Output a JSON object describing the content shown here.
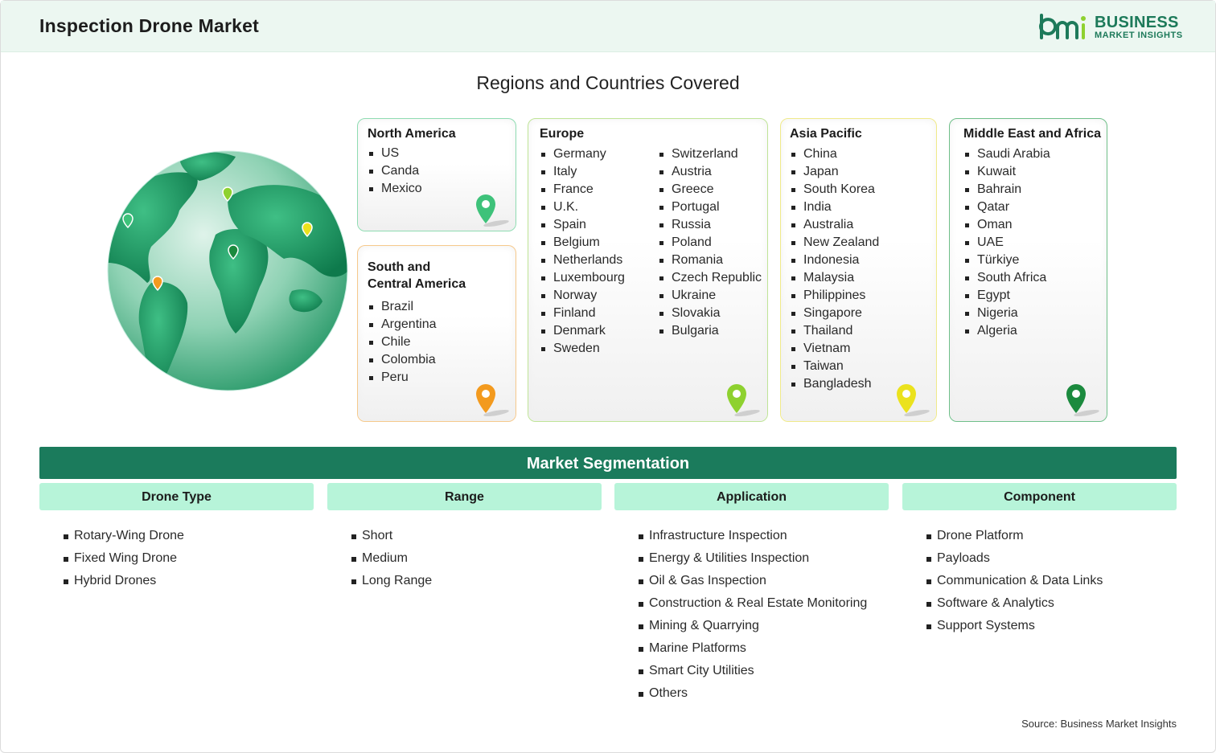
{
  "header": {
    "title": "Inspection Drone Market",
    "logo": {
      "mark": "bmi",
      "line1": "BUSINESS",
      "line2": "MARKET INSIGHTS"
    }
  },
  "regions_title": "Regions and Countries Covered",
  "regions": {
    "north_america": {
      "title": "North America",
      "countries": [
        "US",
        "Canda",
        "Mexico"
      ],
      "pin_color": "#3ec27a"
    },
    "south_central_america": {
      "title_line1": "South and",
      "title_line2": "Central America",
      "countries": [
        "Brazil",
        "Argentina",
        "Chile",
        "Colombia",
        "Peru"
      ],
      "pin_color": "#f39a1e"
    },
    "europe": {
      "title": "Europe",
      "countries_col1": [
        "Germany",
        "Italy",
        "France",
        "U.K.",
        "Spain",
        "Belgium",
        "Netherlands",
        "Luxembourg",
        "Norway",
        "Finland",
        "Denmark",
        "Sweden"
      ],
      "countries_col2": [
        "Switzerland",
        "Austria",
        "Greece",
        "Portugal",
        "Russia",
        "Poland",
        "Romania",
        "Czech Republic",
        "Ukraine",
        "Slovakia",
        "Bulgaria"
      ],
      "pin_color": "#8ed12f"
    },
    "asia_pacific": {
      "title": "Asia Pacific",
      "countries": [
        "China",
        "Japan",
        "South Korea",
        "India",
        "Australia",
        "New Zealand",
        "Indonesia",
        "Malaysia",
        "Philippines",
        "Singapore",
        "Thailand",
        "Vietnam",
        "Taiwan",
        "Bangladesh"
      ],
      "pin_color": "#ebe21d"
    },
    "middle_east_africa": {
      "title": "Middle East and Africa",
      "countries": [
        "Saudi Arabia",
        "Kuwait",
        "Bahrain",
        "Qatar",
        "Oman",
        "UAE",
        "Türkiye",
        "South Africa",
        "Egypt",
        "Nigeria",
        "Algeria"
      ],
      "pin_color": "#1b8a3e"
    }
  },
  "segmentation": {
    "title": "Market Segmentation",
    "columns": [
      {
        "header": "Drone Type",
        "items": [
          "Rotary-Wing Drone",
          "Fixed Wing Drone",
          "Hybrid Drones"
        ]
      },
      {
        "header": "Range",
        "items": [
          "Short",
          "Medium",
          "Long Range"
        ]
      },
      {
        "header": "Application",
        "items": [
          "Infrastructure Inspection",
          "Energy & Utilities Inspection",
          "Oil & Gas Inspection",
          "Construction & Real Estate Monitoring",
          "Mining & Quarrying",
          "Marine Platforms",
          "Smart City Utilities",
          "Others"
        ]
      },
      {
        "header": "Component",
        "items": [
          "Drone Platform",
          "Payloads",
          "Communication & Data Links",
          "Software & Analytics",
          "Support Systems"
        ]
      }
    ]
  },
  "source": "Source: Business Market Insights",
  "colors": {
    "brand": "#1d7a5a",
    "header_bg": "#ecf7f1",
    "seg_bar": "#1b7b5c",
    "seg_head": "#b7f4d9"
  },
  "icons": {
    "globe": "globe-icon",
    "pin": "map-pin-icon"
  }
}
